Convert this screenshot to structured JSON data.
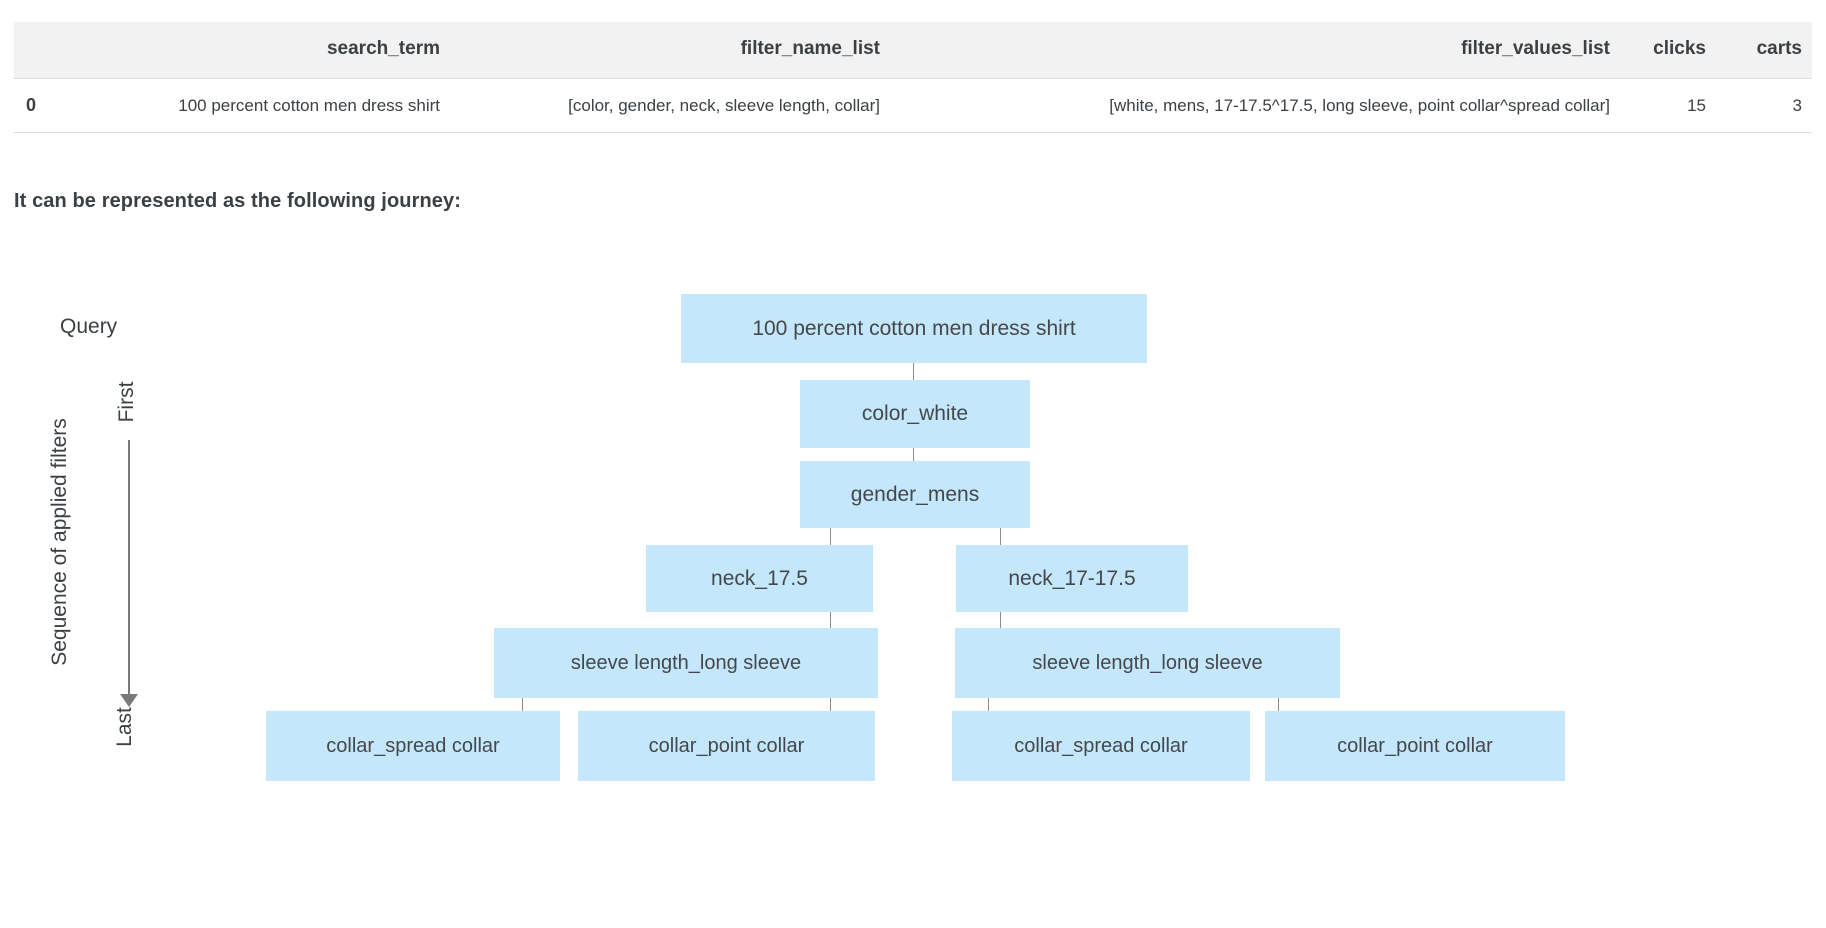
{
  "table": {
    "columns": [
      "",
      "search_term",
      "filter_name_list",
      "filter_values_list",
      "clicks",
      "carts"
    ],
    "rows": [
      {
        "index": "0",
        "search_term": "100 percent cotton men dress shirt",
        "filter_name_list": "[color, gender, neck, sleeve length, collar]",
        "filter_values_list": "[white, mens, 17-17.5^17.5, long sleeve, point collar^spread collar]",
        "clicks": "15",
        "carts": "3"
      }
    ]
  },
  "caption": "It can be represented as the following journey:",
  "diagram": {
    "query_label": "Query",
    "axis_title": "Sequence of applied filters",
    "axis_first": "First",
    "axis_last": "Last",
    "node_color": "#c5e7fb",
    "connector_color": "#8c8c8c",
    "nodes": {
      "root": "100 percent cotton men dress shirt",
      "color": "color_white",
      "gender": "gender_mens",
      "neck_left": "neck_17.5",
      "neck_right": "neck_17-17.5",
      "sleeve_left": "sleeve length_long sleeve",
      "sleeve_right": "sleeve length_long sleeve",
      "collar_1": "collar_spread collar",
      "collar_2": "collar_point collar",
      "collar_3": "collar_spread collar",
      "collar_4": "collar_point collar"
    }
  }
}
